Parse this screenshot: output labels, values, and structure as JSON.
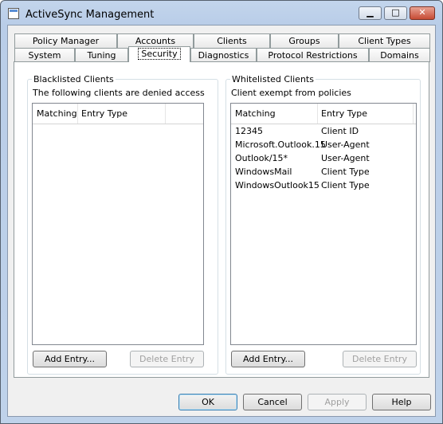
{
  "window": {
    "title": "ActiveSync Management",
    "minimize_glyph": "▁",
    "maximize_glyph": "□",
    "close_glyph": "✕"
  },
  "tabs": {
    "row1": [
      "Policy Manager",
      "Accounts",
      "Clients",
      "Groups",
      "Client Types"
    ],
    "row2": [
      "System",
      "Tuning",
      "Security",
      "Diagnostics",
      "Protocol Restrictions",
      "Domains"
    ],
    "selected": "Security"
  },
  "blacklist": {
    "title": "Blacklisted Clients",
    "description": "The following clients are denied access",
    "columns": [
      "Matching",
      "Entry Type"
    ],
    "rows": [],
    "add_label": "Add Entry...",
    "delete_label": "Delete Entry"
  },
  "whitelist": {
    "title": "Whitelisted Clients",
    "description": "Client exempt from policies",
    "columns": [
      "Matching",
      "Entry Type"
    ],
    "rows": [
      [
        "12345",
        "Client ID"
      ],
      [
        "Microsoft.Outlook.15",
        "User-Agent"
      ],
      [
        "Outlook/15*",
        "User-Agent"
      ],
      [
        "WindowsMail",
        "Client Type"
      ],
      [
        "WindowsOutlook15",
        "Client Type"
      ]
    ],
    "add_label": "Add Entry...",
    "delete_label": "Delete Entry"
  },
  "footer": {
    "ok_label": "OK",
    "cancel_label": "Cancel",
    "apply_label": "Apply",
    "help_label": "Help"
  }
}
